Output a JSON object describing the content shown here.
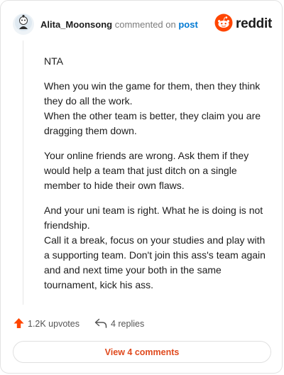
{
  "comment": {
    "username": "Alita_Moonsong",
    "action_text": "commented on",
    "post_link": "post",
    "brand": "reddit",
    "paragraphs": [
      {
        "lines": [
          "NTA"
        ]
      },
      {
        "lines": [
          "When you win the game for them, then they think they do all the work.",
          "When the other team is better, they claim you are dragging them down."
        ]
      },
      {
        "lines": [
          "Your online friends are wrong. Ask them if they would help a team that just ditch on a single member to hide their own flaws."
        ]
      },
      {
        "lines": [
          "And your uni team is right. What he is doing is not friendship.",
          "Call it a break, focus on your studies and play with a supporting team. Don't join this ass's team again and and next time your both in the same tournament, kick his ass."
        ]
      }
    ],
    "upvotes": "1.2K upvotes",
    "replies": "4 replies",
    "view_comments": "View 4 comments"
  },
  "colors": {
    "brand_orange": "#ff4500",
    "link_blue": "#0079d3",
    "view_text": "#e04a1e"
  },
  "icons": {
    "avatar": "snoo-avatar-icon",
    "brand_logo": "reddit-logo-icon",
    "upvote": "upvote-arrow-icon",
    "reply": "reply-arrow-icon"
  }
}
